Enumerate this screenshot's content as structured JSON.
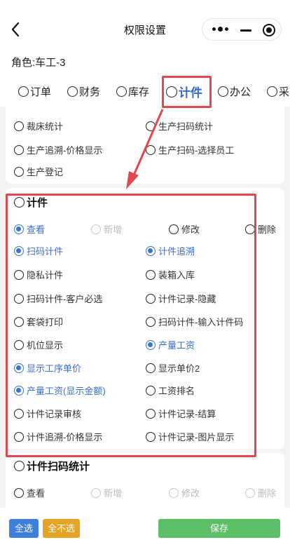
{
  "nav": {
    "title": "权限设置"
  },
  "role": {
    "label": "角色:车工-3"
  },
  "tabs": [
    "订单",
    "财务",
    "库存",
    "计件",
    "办公",
    "采"
  ],
  "top_card": {
    "items": [
      "裁床统计",
      "生产扫码统计",
      "生产追溯-价格显示",
      "生产扫码-选择员工",
      "生产登记"
    ]
  },
  "jijian": {
    "title": "计件",
    "actions": [
      "查看",
      "新增",
      "修改",
      "删除"
    ],
    "items": [
      "扫码计件",
      "计件追溯",
      "隐私计件",
      "装箱入库",
      "扫码计件-客户必选",
      "计件记录-隐藏",
      "套袋打印",
      "扫码计件-输入计件码",
      "机位显示",
      "产量工资",
      "显示工序单价",
      "显示单价2",
      "产量工资(显示金额)",
      "工资排名",
      "计件记录审核",
      "计件记录-结算",
      "计件追溯-价格显示",
      "计件记录-图片显示"
    ]
  },
  "scan_stats": {
    "title": "计件扫码统计",
    "actions": [
      "查看",
      "新增",
      "修改",
      "删除"
    ]
  },
  "buttons": {
    "select_all": "全选",
    "select_none": "全不选",
    "save": "保存"
  },
  "colors": {
    "accent": "#3a73d6",
    "highlight": "#e1474e",
    "save": "#5cbf67",
    "warn": "#e6a326"
  }
}
